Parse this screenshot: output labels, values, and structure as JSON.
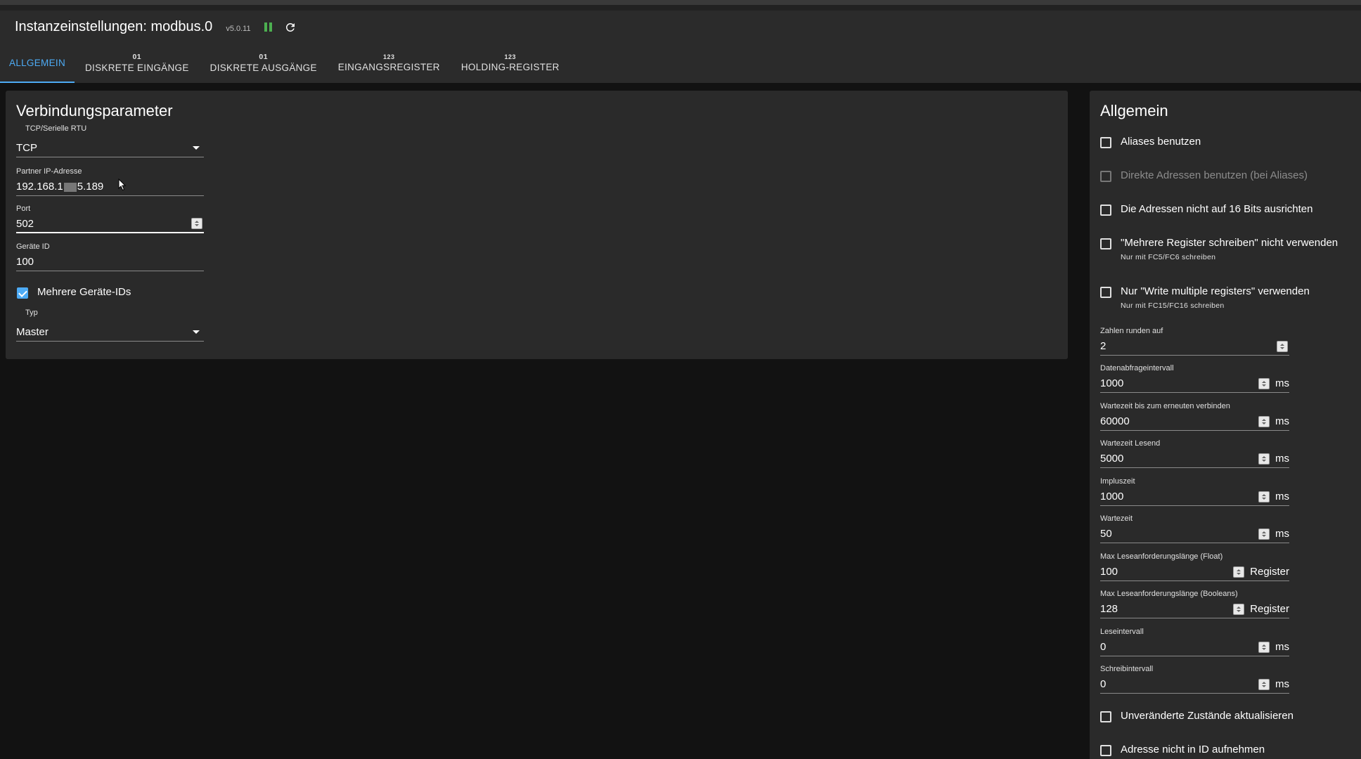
{
  "header": {
    "title": "Instanzeinstellungen: modbus.0",
    "version": "v5.0.11"
  },
  "tabs": [
    {
      "badge": "",
      "label": "ALLGEMEIN"
    },
    {
      "badge": "01",
      "label": "DISKRETE EINGÄNGE"
    },
    {
      "badge": "01",
      "label": "DISKRETE AUSGÄNGE"
    },
    {
      "badge": "123",
      "label": "EINGANGSREGISTER"
    },
    {
      "badge": "123",
      "label": "HOLDING-REGISTER"
    }
  ],
  "connection": {
    "title": "Verbindungsparameter",
    "mode_label": "TCP/Serielle RTU",
    "mode_value": "TCP",
    "ip_label": "Partner IP-Adresse",
    "ip_prefix": "192.168.1",
    "ip_suffix": "5.189",
    "port_label": "Port",
    "port_value": "502",
    "device_id_label": "Geräte ID",
    "device_id_value": "100",
    "multi_ids_label": "Mehrere Geräte-IDs",
    "type_label": "Typ",
    "type_value": "Master"
  },
  "general": {
    "title": "Allgemein",
    "checkboxes": [
      {
        "label": "Aliases benutzen",
        "help": ""
      },
      {
        "label": "Direkte Adressen benutzen (bei Aliases)",
        "help": ""
      },
      {
        "label": "Die Adressen nicht auf 16 Bits ausrichten",
        "help": ""
      },
      {
        "label": "\"Mehrere Register schreiben\" nicht verwenden",
        "help": "Nur mit FC5/FC6 schreiben"
      },
      {
        "label": "Nur \"Write multiple registers\" verwenden",
        "help": "Nur mit FC15/FC16 schreiben"
      }
    ],
    "fields": [
      {
        "label": "Zahlen runden auf",
        "value": "2",
        "unit": ""
      },
      {
        "label": "Datenabfrageintervall",
        "value": "1000",
        "unit": "ms"
      },
      {
        "label": "Wartezeit bis zum erneuten verbinden",
        "value": "60000",
        "unit": "ms"
      },
      {
        "label": "Wartezeit Lesend",
        "value": "5000",
        "unit": "ms"
      },
      {
        "label": "Impluszeit",
        "value": "1000",
        "unit": "ms"
      },
      {
        "label": "Wartezeit",
        "value": "50",
        "unit": "ms"
      },
      {
        "label": "Max Leseanforderungslänge (Float)",
        "value": "100",
        "unit": "Register"
      },
      {
        "label": "Max Leseanforderungslänge (Booleans)",
        "value": "128",
        "unit": "Register"
      },
      {
        "label": "Leseintervall",
        "value": "0",
        "unit": "ms"
      },
      {
        "label": "Schreibintervall",
        "value": "0",
        "unit": "ms"
      }
    ],
    "bottom_checkboxes": [
      {
        "label": "Unveränderte Zustände aktualisieren"
      },
      {
        "label": "Adresse nicht in ID aufnehmen"
      }
    ]
  },
  "colors": {
    "accent": "#4dabf5",
    "running": "#4caf50",
    "panel": "#2a2a2a",
    "background": "#121212"
  },
  "icons": [
    "pause-icon",
    "reload-icon",
    "dropdown-caret-icon",
    "spinner-icon",
    "checkbox-icon",
    "mouse-cursor-icon"
  ]
}
